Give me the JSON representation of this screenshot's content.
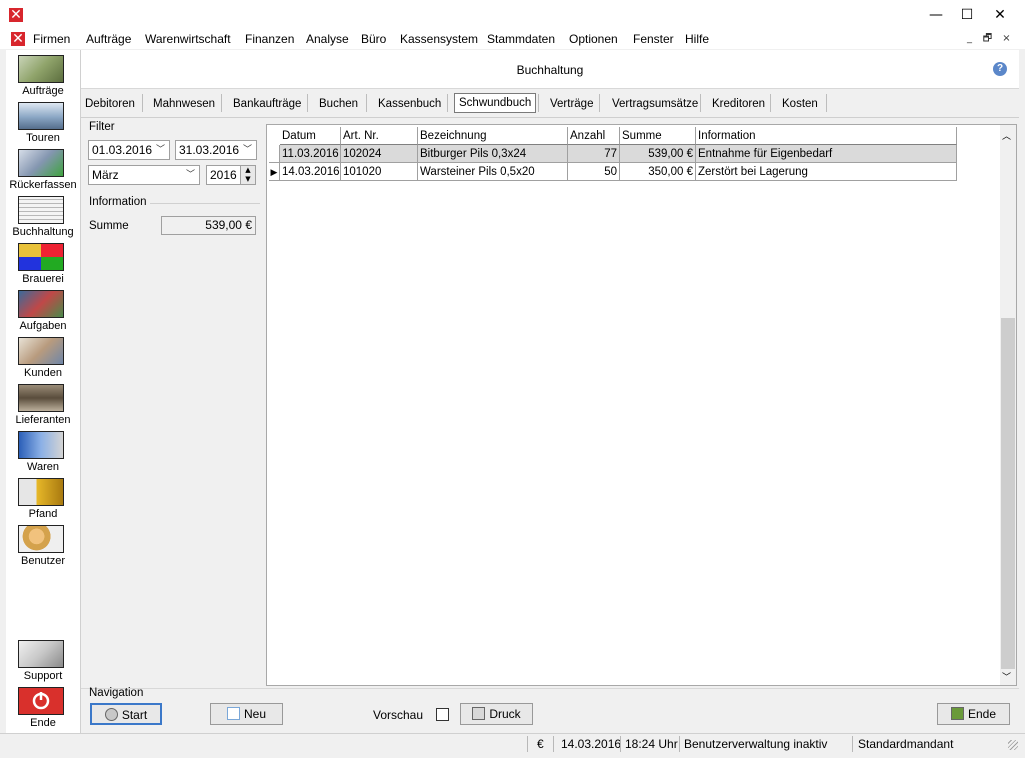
{
  "window": {
    "minimize": "—",
    "maximize": "☐",
    "close": "✕"
  },
  "menu": {
    "items": [
      "Firmen",
      "Aufträge",
      "Warenwirtschaft",
      "Finanzen",
      "Analyse",
      "Büro",
      "Kassensystem",
      "Stammdaten",
      "Optionen",
      "Fenster",
      "Hilfe"
    ],
    "mdi_min": "_",
    "mdi_restore": "🗗",
    "mdi_close": "×"
  },
  "sidebar": {
    "items": [
      {
        "label": "Aufträge",
        "icon": "headset-operator-icon"
      },
      {
        "label": "Touren",
        "icon": "truck-icon"
      },
      {
        "label": "Rückerfassen",
        "icon": "truck-check-icon"
      },
      {
        "label": "Buchhaltung",
        "icon": "ledger-icon"
      },
      {
        "label": "Brauerei",
        "icon": "brewery-icon"
      },
      {
        "label": "Aufgaben",
        "icon": "tasks-icon"
      },
      {
        "label": "Kunden",
        "icon": "customers-icon"
      },
      {
        "label": "Lieferanten",
        "icon": "suppliers-icon"
      },
      {
        "label": "Waren",
        "icon": "goods-icon"
      },
      {
        "label": "Pfand",
        "icon": "crates-icon"
      },
      {
        "label": "Benutzer",
        "icon": "user-lock-icon"
      }
    ],
    "support_label": "Support",
    "end_label": "Ende"
  },
  "header": {
    "title": "Buchhaltung",
    "help": "?"
  },
  "tabs": [
    {
      "label": "Debitoren",
      "active": false
    },
    {
      "label": "Mahnwesen",
      "active": false
    },
    {
      "label": "Bankaufträge",
      "active": false
    },
    {
      "label": "Buchen",
      "active": false
    },
    {
      "label": "Kassenbuch",
      "active": false
    },
    {
      "label": "Schwundbuch",
      "active": true
    },
    {
      "label": "Verträge",
      "active": false
    },
    {
      "label": "Vertragsumsätze",
      "active": false
    },
    {
      "label": "Kreditoren",
      "active": false
    },
    {
      "label": "Kosten",
      "active": false
    }
  ],
  "filter": {
    "group_label": "Filter",
    "date_from": "01.03.2016",
    "date_to": "31.03.2016",
    "month": "März",
    "year": "2016"
  },
  "information": {
    "group_label": "Information",
    "sum_label": "Summe",
    "sum_value": "539,00 €"
  },
  "grid": {
    "columns": [
      "Datum",
      "Art. Nr.",
      "Bezeichnung",
      "Anzahl",
      "Summe",
      "Information"
    ],
    "rows": [
      [
        "11.03.2016",
        "102024",
        "Bitburger Pils 0,3x24",
        "77",
        "539,00 €",
        "Entnahme für Eigenbedarf"
      ],
      [
        "14.03.2016",
        "101020",
        "Warsteiner Pils 0,5x20",
        "50",
        "350,00 €",
        "Zerstört bei Lagerung"
      ]
    ],
    "selected_row": 0,
    "current_row": 1
  },
  "navigation": {
    "group_label": "Navigation",
    "start_label": "Start",
    "new_label": "Neu",
    "preview_label": "Vorschau",
    "print_label": "Druck",
    "end_label": "Ende"
  },
  "status": {
    "currency": "€",
    "date": "14.03.2016",
    "time": "18:24 Uhr",
    "user_admin": "Benutzerverwaltung inaktiv",
    "client": "Standardmandant"
  }
}
